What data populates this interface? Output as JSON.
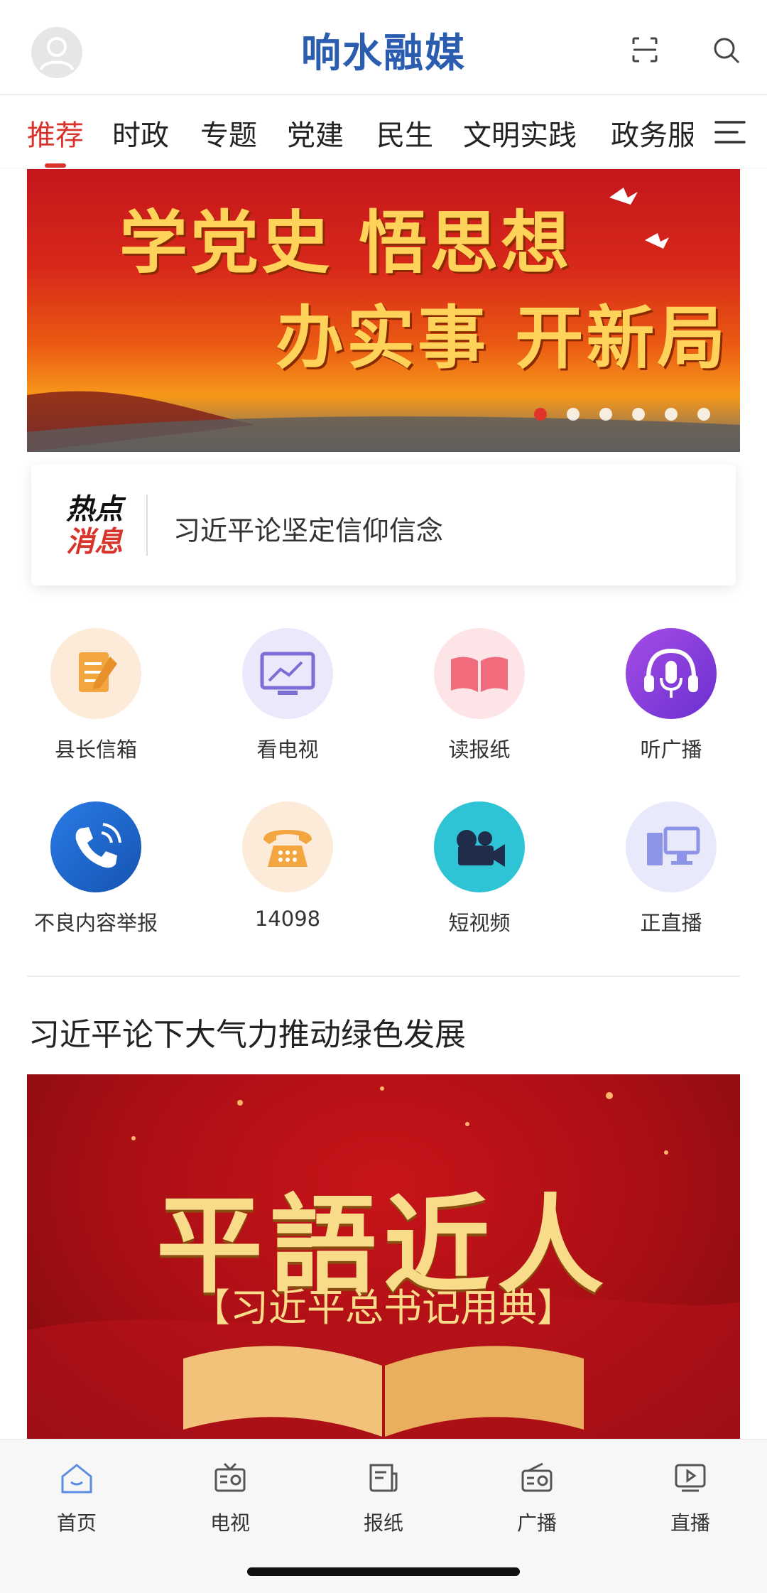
{
  "header": {
    "app_title": "响水融媒",
    "avatar_icon": "user-avatar-icon",
    "scan_icon": "scan-icon",
    "search_icon": "search-icon"
  },
  "tabs": {
    "items": [
      "推荐",
      "时政",
      "专题",
      "党建",
      "民生",
      "文明实践",
      "政务服"
    ],
    "active": "推荐",
    "active_color": "#d9342b",
    "menu_icon": "menu-icon"
  },
  "banner": {
    "line1": "学党史 悟思想",
    "line2": "办实事 开新局",
    "slide_count": 6,
    "active_slide": 1
  },
  "hot_news": {
    "badge_line1": "热点",
    "badge_line2": "消息",
    "headline": "习近平论坚定信仰信念"
  },
  "services": [
    {
      "label": "县长信箱",
      "icon": "letter-pen-icon"
    },
    {
      "label": "看电视",
      "icon": "tv-monitor-icon"
    },
    {
      "label": "读报纸",
      "icon": "open-book-icon"
    },
    {
      "label": "听广播",
      "icon": "microphone-headphones-icon"
    },
    {
      "label": "不良内容举报",
      "icon": "phone-call-icon"
    },
    {
      "label": "14098",
      "icon": "telephone-icon"
    },
    {
      "label": "短视频",
      "icon": "video-camera-icon"
    },
    {
      "label": "正直播",
      "icon": "computer-icon"
    }
  ],
  "article": {
    "title": "习近平论下大气力推动绿色发展",
    "image_title": "平語近人",
    "image_subtitle": "【习近平总书记用典】"
  },
  "bottom_nav": [
    {
      "label": "首页",
      "icon": "home-icon",
      "active": true
    },
    {
      "label": "电视",
      "icon": "tv-icon",
      "active": false
    },
    {
      "label": "报纸",
      "icon": "newspaper-icon",
      "active": false
    },
    {
      "label": "广播",
      "icon": "radio-icon",
      "active": false
    },
    {
      "label": "直播",
      "icon": "live-play-icon",
      "active": false
    }
  ],
  "colors": {
    "brand_blue": "#2a5db0",
    "accent_red": "#d9342b"
  }
}
